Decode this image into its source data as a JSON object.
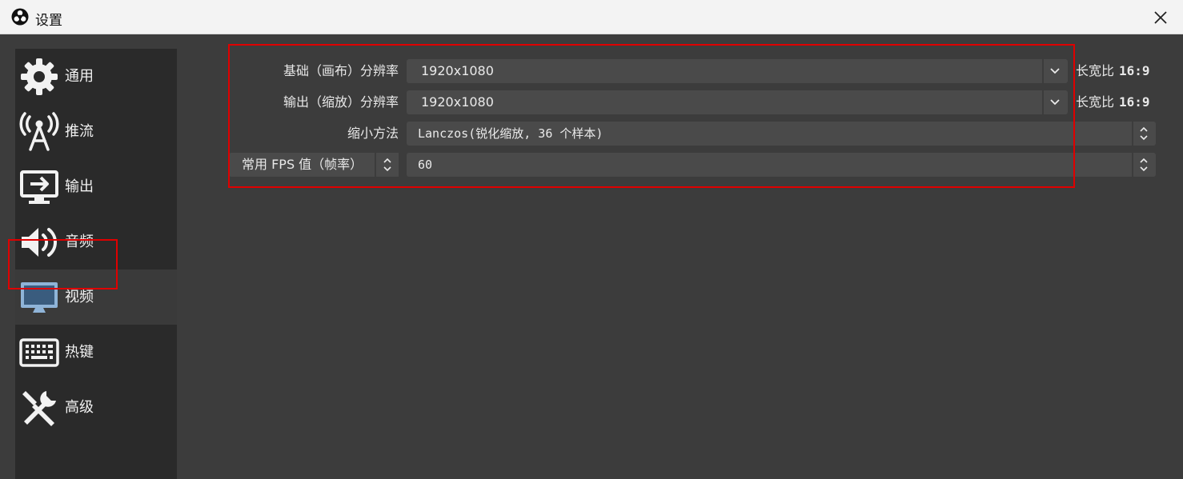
{
  "window": {
    "title": "设置",
    "close_icon": "close-icon"
  },
  "sidebar": {
    "items": [
      {
        "label": "通用",
        "icon": "gear-icon"
      },
      {
        "label": "推流",
        "icon": "broadcast-tower-icon"
      },
      {
        "label": "输出",
        "icon": "monitor-output-icon"
      },
      {
        "label": "音频",
        "icon": "speaker-icon"
      },
      {
        "label": "视频",
        "icon": "monitor-icon"
      },
      {
        "label": "热键",
        "icon": "keyboard-icon"
      },
      {
        "label": "高级",
        "icon": "tools-icon"
      }
    ],
    "selected": "视频"
  },
  "video": {
    "base_resolution": {
      "label": "基础（画布）分辨率",
      "value": "1920x1080",
      "aspect_label": "长宽比",
      "aspect_value": "16:9"
    },
    "output_resolution": {
      "label": "输出（缩放）分辨率",
      "value": "1920x1080",
      "aspect_label": "长宽比",
      "aspect_value": "16:9"
    },
    "downscale_filter": {
      "label": "缩小方法",
      "value": "Lanczos(锐化缩放, 36 个样本)"
    },
    "fps": {
      "type_label": "常用 FPS 值（帧率）",
      "value": "60"
    }
  },
  "colors": {
    "highlight": "#e00000",
    "selected_icon": "#8fb4d8"
  }
}
